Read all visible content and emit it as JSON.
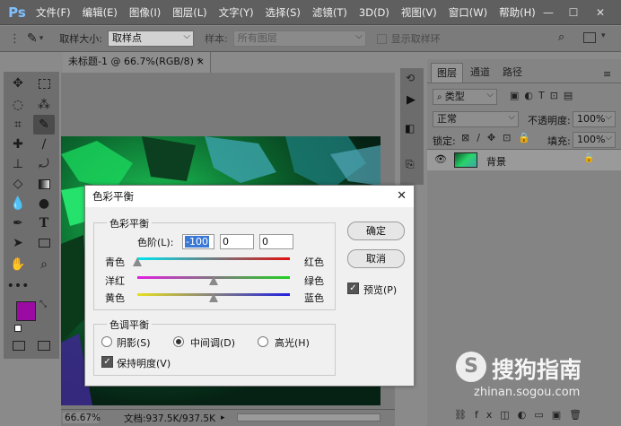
{
  "app": {
    "logo": "Ps"
  },
  "menubar": {
    "items": [
      "文件(F)",
      "编辑(E)",
      "图像(I)",
      "图层(L)",
      "文字(Y)",
      "选择(S)",
      "滤镜(T)",
      "3D(D)",
      "视图(V)",
      "窗口(W)",
      "帮助(H)"
    ]
  },
  "options_bar": {
    "sample_size_label": "取样大小:",
    "sample_size_value": "取样点",
    "sample_label": "样本:",
    "sample_value": "所有图层",
    "show_ring_label": "显示取样环"
  },
  "document": {
    "tab_title": "未标题-1 @ 66.7%(RGB/8) *",
    "zoom": "66.67%",
    "doc_info": "文档:937.5K/937.5K"
  },
  "layers_panel": {
    "tabs": [
      "图层",
      "通道",
      "路径"
    ],
    "filter_label": "类型",
    "blend_mode": "正常",
    "opacity_label": "不透明度:",
    "opacity_value": "100%",
    "lock_label": "锁定:",
    "fill_label": "填充:",
    "fill_value": "100%",
    "layers": [
      {
        "name": "背景"
      }
    ]
  },
  "dialog": {
    "title": "色彩平衡",
    "color_balance_group": "色彩平衡",
    "levels_label": "色阶(L):",
    "levels": [
      "-100",
      "0",
      "0"
    ],
    "sliders": [
      {
        "left": "青色",
        "right": "红色",
        "value": -100
      },
      {
        "left": "洋红",
        "right": "绿色",
        "value": 0
      },
      {
        "left": "黄色",
        "right": "蓝色",
        "value": 0
      }
    ],
    "tone_balance_group": "色调平衡",
    "tones": [
      {
        "label": "阴影(S)",
        "selected": false
      },
      {
        "label": "中间调(D)",
        "selected": true
      },
      {
        "label": "高光(H)",
        "selected": false
      }
    ],
    "preserve_luminosity_label": "保持明度(V)",
    "preserve_luminosity_checked": true,
    "ok_label": "确定",
    "cancel_label": "取消",
    "preview_label": "预览(P)",
    "preview_checked": true
  },
  "watermark": {
    "brand": "搜狗指南",
    "url": "zhinan.sogou.com"
  },
  "colors": {
    "foreground": "#9b0aa3",
    "background": "#ffffff",
    "menubar": "#5f5f5f",
    "dialog_bg": "#f0f0f0"
  }
}
